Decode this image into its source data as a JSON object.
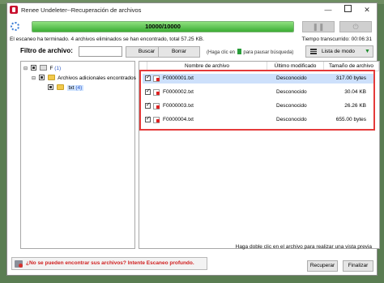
{
  "window": {
    "title": "Renee Undeleter--Recuperación de archivos",
    "controls": {
      "minimize": "—",
      "maximize": "",
      "close": "✕"
    }
  },
  "scan": {
    "progress_text": "10000/10000",
    "progress_fraction": 1.0,
    "status_text": "El escaneo ha terminado. 4 archivos eliminados se han encontrado, total 57.25 KB.",
    "elapsed_text": "Tiempo transcurrido: 00:06:31",
    "pause_icon": "pause-icon",
    "stop_icon": "stop-icon"
  },
  "filter": {
    "label": "Filtro de archivo:",
    "input_value": "",
    "search_label": "Buscar",
    "clear_label": "Borrar",
    "pause_hint": "(Haga clic en",
    "pause_hint_tail": "para pausar búsqueda)",
    "mode_label": "Lista de modo",
    "mode_arrow": "▼"
  },
  "tree": {
    "nodes": [
      {
        "expander": "⊟",
        "name": "F",
        "count": "(1)"
      },
      {
        "expander": "⊟",
        "name": "Archivos adicionales encontrados",
        "count": ""
      },
      {
        "expander": "",
        "name": "txt",
        "count": "(4)"
      }
    ]
  },
  "files": {
    "columns": {
      "name": "Nombre de archivo",
      "modified": "Último modificado",
      "size": "Tamaño de archivo"
    },
    "rows": [
      {
        "name": "F0000001.txt",
        "modified": "Desconocido",
        "size": "317.00 bytes"
      },
      {
        "name": "F0000002.txt",
        "modified": "Desconocido",
        "size": "30.04 KB"
      },
      {
        "name": "F0000003.txt",
        "modified": "Desconocido",
        "size": "26.26 KB"
      },
      {
        "name": "F0000004.txt",
        "modified": "Desconocido",
        "size": "655.00 bytes"
      }
    ]
  },
  "preview_hint": "Haga doble clic en el archivo para realizar una vista previa",
  "footer": {
    "deep_scan_text": "¿No se pueden encontrar sus archivos? Intente Escaneo profundo.",
    "recover_label": "Recuperar",
    "finish_label": "Finalizar"
  },
  "colors": {
    "progress_fill": "#3cae35",
    "highlight": "#e53a3a",
    "deep_scan_link": "#d02020"
  }
}
